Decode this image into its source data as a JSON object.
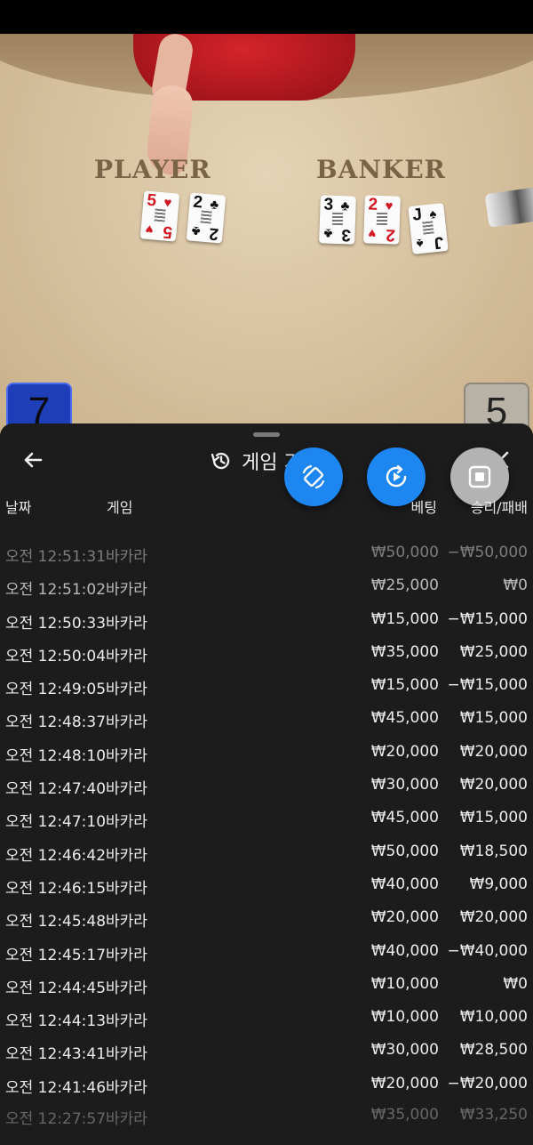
{
  "video": {
    "player_label": "PLAYER",
    "banker_label": "BANKER",
    "player_cards": [
      {
        "rank": "5",
        "suit": "♥",
        "color": "red"
      },
      {
        "rank": "2",
        "suit": "♣",
        "color": "blk"
      }
    ],
    "banker_cards": [
      {
        "rank": "3",
        "suit": "♣",
        "color": "blk"
      },
      {
        "rank": "2",
        "suit": "♥",
        "color": "red"
      },
      {
        "rank": "J",
        "suit": "♠",
        "color": "blk"
      }
    ],
    "player_score": "7",
    "banker_score": "5"
  },
  "sheet": {
    "title": "게임 기",
    "columns": {
      "date": "날짜",
      "game": "게임",
      "bet": "베팅",
      "win_loss": "승리/패배"
    },
    "rows": [
      {
        "time": "오전 12:51:31",
        "game": "바카라",
        "bet": "₩50,000",
        "result": "−₩50,000"
      },
      {
        "time": "오전 12:51:02",
        "game": "바카라",
        "bet": "₩25,000",
        "result": "₩0"
      },
      {
        "time": "오전 12:50:33",
        "game": "바카라",
        "bet": "₩15,000",
        "result": "−₩15,000"
      },
      {
        "time": "오전 12:50:04",
        "game": "바카라",
        "bet": "₩35,000",
        "result": "₩25,000"
      },
      {
        "time": "오전 12:49:05",
        "game": "바카라",
        "bet": "₩15,000",
        "result": "−₩15,000"
      },
      {
        "time": "오전 12:48:37",
        "game": "바카라",
        "bet": "₩45,000",
        "result": "₩15,000"
      },
      {
        "time": "오전 12:48:10",
        "game": "바카라",
        "bet": "₩20,000",
        "result": "₩20,000"
      },
      {
        "time": "오전 12:47:40",
        "game": "바카라",
        "bet": "₩30,000",
        "result": "₩20,000"
      },
      {
        "time": "오전 12:47:10",
        "game": "바카라",
        "bet": "₩45,000",
        "result": "₩15,000"
      },
      {
        "time": "오전 12:46:42",
        "game": "바카라",
        "bet": "₩50,000",
        "result": "₩18,500"
      },
      {
        "time": "오전 12:46:15",
        "game": "바카라",
        "bet": "₩40,000",
        "result": "₩9,000"
      },
      {
        "time": "오전 12:45:48",
        "game": "바카라",
        "bet": "₩20,000",
        "result": "₩20,000"
      },
      {
        "time": "오전 12:45:17",
        "game": "바카라",
        "bet": "₩40,000",
        "result": "−₩40,000"
      },
      {
        "time": "오전 12:44:45",
        "game": "바카라",
        "bet": "₩10,000",
        "result": "₩0"
      },
      {
        "time": "오전 12:44:13",
        "game": "바카라",
        "bet": "₩10,000",
        "result": "₩10,000"
      },
      {
        "time": "오전 12:43:41",
        "game": "바카라",
        "bet": "₩30,000",
        "result": "₩28,500"
      },
      {
        "time": "오전 12:41:46",
        "game": "바카라",
        "bet": "₩20,000",
        "result": "−₩20,000"
      },
      {
        "time": "오전 12:27:57",
        "game": "바카라",
        "bet": "₩35,000",
        "result": "₩33,250"
      }
    ]
  },
  "colors": {
    "sheet_bg": "#1c1c1d",
    "fab_blue": "#1e86f0",
    "fab_gray": "#b3b3b3",
    "player_score_bg": "#1e3fb8"
  },
  "icons": [
    "back-arrow-icon",
    "history-icon",
    "close-icon",
    "rotate-screen-icon",
    "replay-icon",
    "stop-icon"
  ]
}
